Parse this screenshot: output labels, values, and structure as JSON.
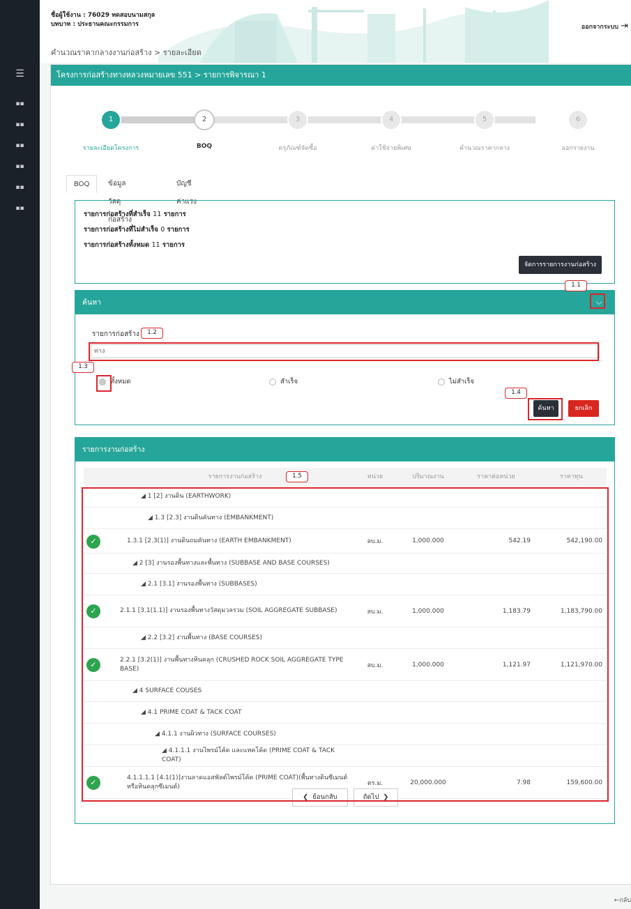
{
  "header": {
    "user_line": "ชื่อผู้ใช้งาน : 76029 ทดสอบนามสกุล",
    "role_line": "บทบาท : ประธานคณะกรรมการ",
    "logout_label": "ออกจากระบบ",
    "breadcrumb": "คำนวณราคากลางงานก่อสร้าง > รายละเอียด"
  },
  "sidebar": {
    "menu_icon": "menu-icon",
    "item_icon": "grid-icon"
  },
  "project_title": "โครงการก่อสร้างทางหลวงหมายเลข 551 > รายการพิจารณา 1",
  "steps": [
    {
      "num": "1",
      "label": "รายละเอียดโครงการ"
    },
    {
      "num": "2",
      "label": "BOQ"
    },
    {
      "num": "3",
      "label": "ครุภัณฑ์จัดซื้อ"
    },
    {
      "num": "4",
      "label": "ค่าใช้จ่ายพิเศษ"
    },
    {
      "num": "5",
      "label": "คำนวณราคากลาง"
    },
    {
      "num": "6",
      "label": "ออกรายงาน"
    }
  ],
  "tabs": [
    "BOQ",
    "ข้อมูลวัสดุก่อสร้าง",
    "บัญชีค่าแรง"
  ],
  "summary": {
    "success_label": "รายการก่อสร้างที่สำเร็จ",
    "success_count": "11",
    "success_unit": "รายการ",
    "fail_label": "รายการก่อสร้างที่ไม่สำเร็จ",
    "fail_count": "0",
    "fail_unit": "รายการ",
    "all_label": "รายการก่อสร้างทั้งหมด",
    "all_count": "11",
    "all_unit": "รายการ",
    "manage_button": "จัดการรายการงานก่อสร้าง"
  },
  "search": {
    "title": "ค้นหา",
    "field_label": "รายการก่อสร้าง",
    "field_value": "ทาง",
    "radio_all": "ทั้งหมด",
    "radio_success": "สำเร็จ",
    "radio_fail": "ไม่สำเร็จ",
    "search_button": "ค้นหา",
    "cancel_button": "ยกเลิก"
  },
  "list": {
    "title": "รายการงานก่อสร้าง",
    "columns": [
      "รายการงานก่อสร้าง",
      "หน่วย",
      "ปริมาณงาน",
      "ราคาต่อหน่วย",
      "ราคาทุน"
    ],
    "rows": [
      {
        "name": "◢ 1 [2] งานดิน (EARTHWORK)",
        "unit": "",
        "qty": "",
        "unit_price": "",
        "total": ""
      },
      {
        "name": "◢ 1.3 [2.3] งานดินคันทาง (EMBANKMENT)",
        "unit": "",
        "qty": "",
        "unit_price": "",
        "total": ""
      },
      {
        "name": "1.3.1 [2.3(1)] งานดินถมคันทาง (EARTH EMBANKMENT)",
        "unit": "ลบ.ม.",
        "qty": "1,000.000",
        "unit_price": "542.19",
        "total": "542,190.00"
      },
      {
        "name": "◢ 2 [3] งานรองพื้นทางและพื้นทาง (SUBBASE AND BASE COURSES)",
        "unit": "",
        "qty": "",
        "unit_price": "",
        "total": ""
      },
      {
        "name": "◢ 2.1 [3.1] งานรองพื้นทาง (SUBBASES)",
        "unit": "",
        "qty": "",
        "unit_price": "",
        "total": ""
      },
      {
        "name": "2.1.1 [3.1(1.1)] งานรองพื้นทางวัสดุมวลรวม (SOIL AGGREGATE SUBBASE)",
        "unit": "ลบ.ม.",
        "qty": "1,000.000",
        "unit_price": "1,183.79",
        "total": "1,183,790.00"
      },
      {
        "name": "◢ 2.2 [3.2] งานพื้นทาง (BASE COURSES)",
        "unit": "",
        "qty": "",
        "unit_price": "",
        "total": ""
      },
      {
        "name": "2.2.1 [3.2(1)] งานพื้นทางหินคลุก (CRUSHED ROCK SOIL AGGREGATE TYPE BASE)",
        "unit": "ลบ.ม.",
        "qty": "1,000.000",
        "unit_price": "1,121.97",
        "total": "1,121,970.00"
      },
      {
        "name": "◢ 4 SURFACE COUSES",
        "unit": "",
        "qty": "",
        "unit_price": "",
        "total": ""
      },
      {
        "name": "◢ 4.1 PRIME COAT & TACK COAT",
        "unit": "",
        "qty": "",
        "unit_price": "",
        "total": ""
      },
      {
        "name": "◢ 4.1.1 งานผิวทาง (SURFACE COURSES)",
        "unit": "",
        "qty": "",
        "unit_price": "",
        "total": ""
      },
      {
        "name": "◢ 4.1.1.1 งานไพรม์โค้ด และแทคโค้ด (PRIME COAT & TACK COAT)",
        "unit": "",
        "qty": "",
        "unit_price": "",
        "total": ""
      },
      {
        "name": "4.1.1.1.1 [4.1(1)]งานลาดแอสฟัลต์ไพรม์โค้ด (PRIME COAT)(พื้นทางดินซีเมนต์หรือหินคลุกซีเมนต์)",
        "unit": "ตร.ม.",
        "qty": "20,000.000",
        "unit_price": "7.98",
        "total": "159,600.00"
      }
    ]
  },
  "pager": {
    "prev": "ย้อนกลับ",
    "next": "ถัดไป"
  },
  "back_link": "←กลับ",
  "annotations": [
    "1.1",
    "1.2",
    "1.3",
    "1.4",
    "1.5"
  ],
  "colors": {
    "teal": "#26a69a",
    "dark": "#2b2f38",
    "red": "#d9261e",
    "check": "#2ea44f",
    "annotation": "#d9262c"
  }
}
